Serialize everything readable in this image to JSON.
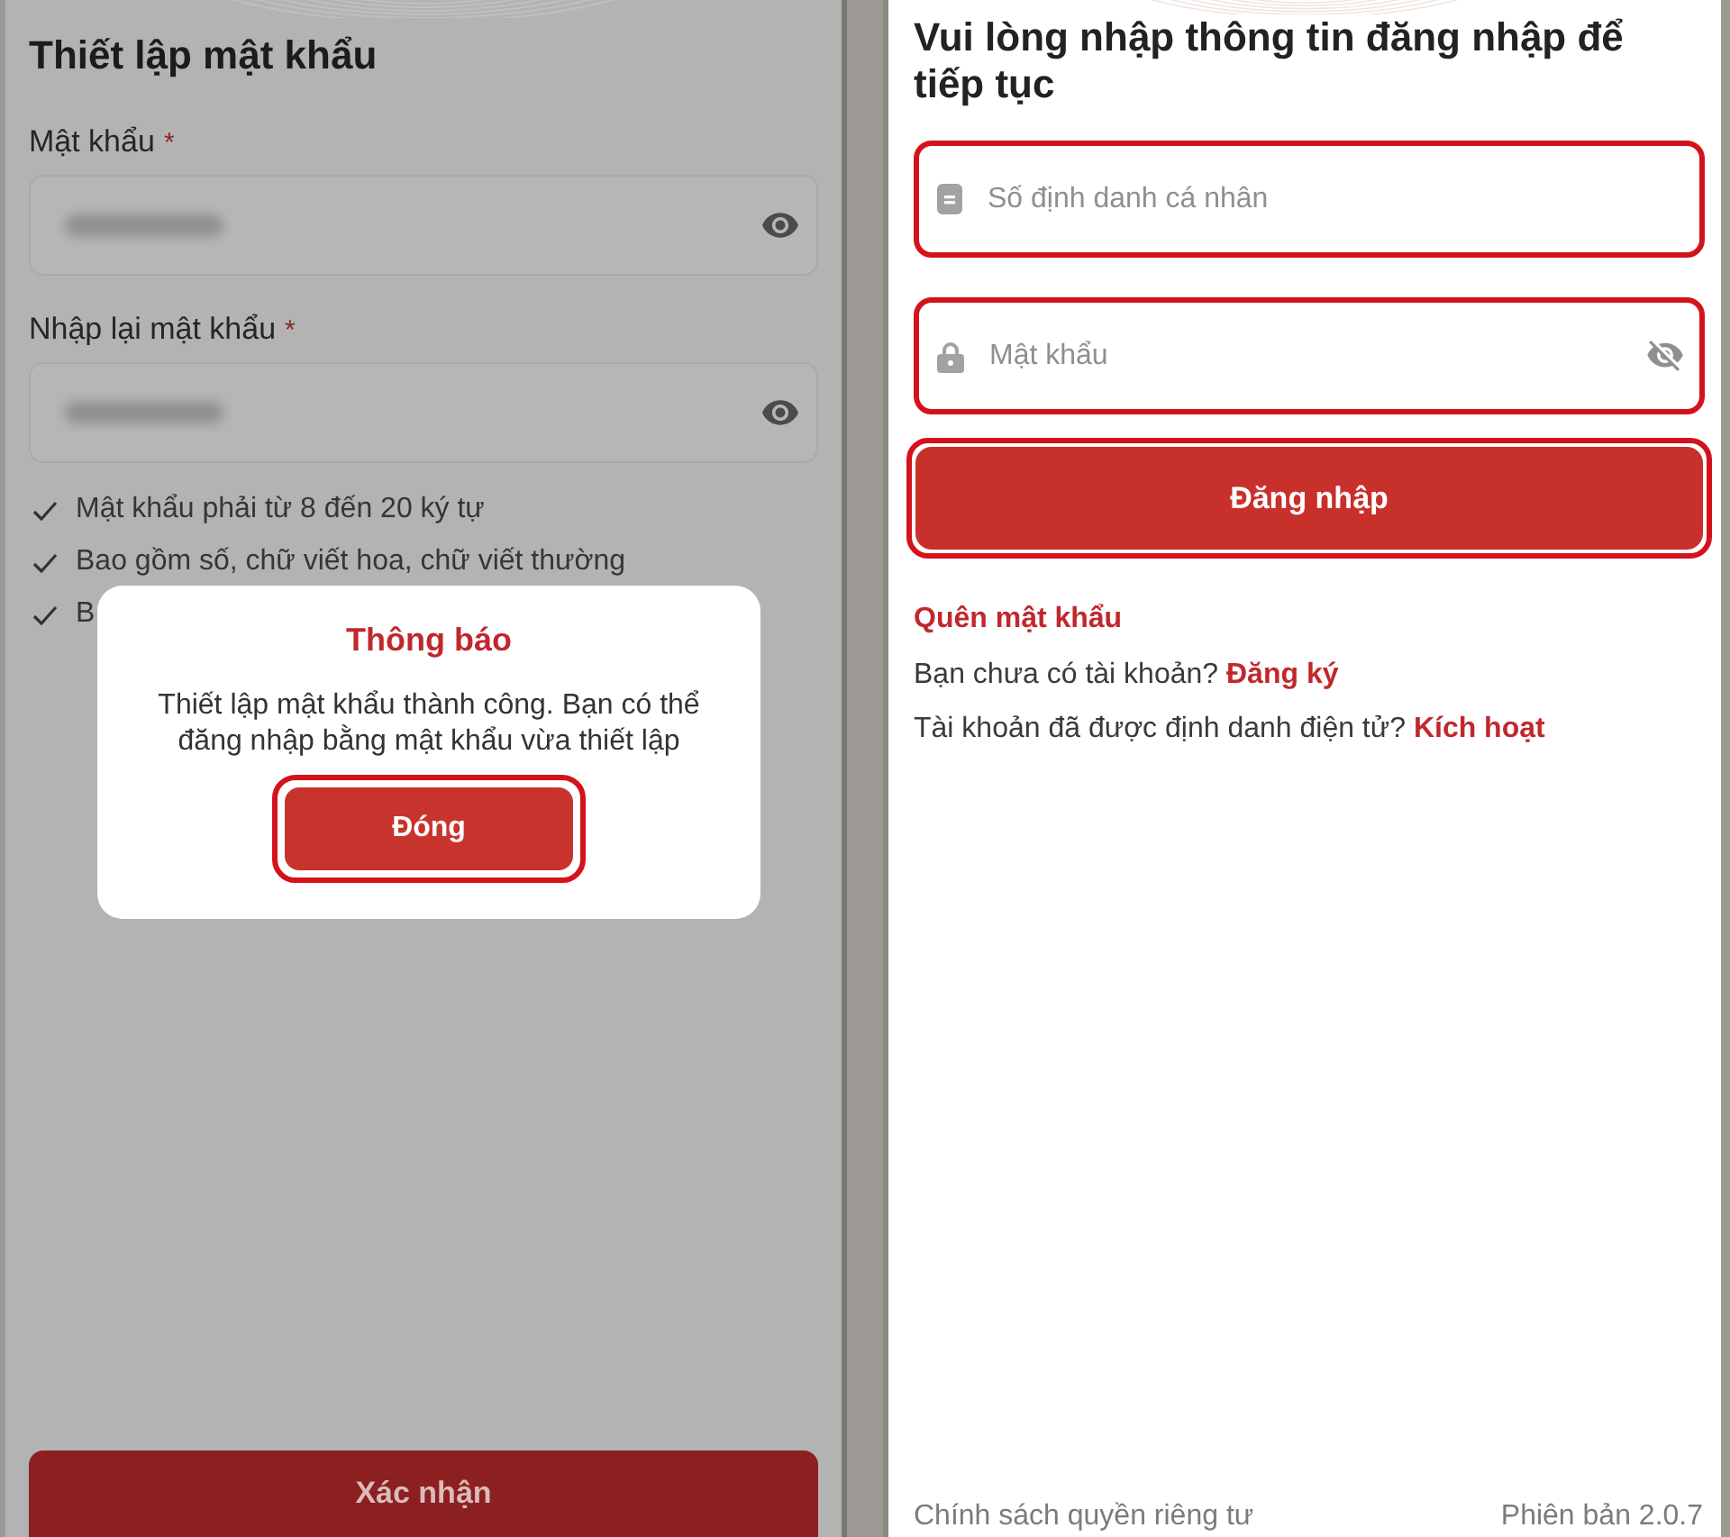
{
  "setup_screen": {
    "title": "Thiết lập mật khẩu",
    "fields": [
      {
        "label": "Mật khẩu",
        "required_mark": "*",
        "blurred": true
      },
      {
        "label": "Nhập lại mật khẩu",
        "required_mark": "*",
        "blurred": true
      }
    ],
    "rules": [
      "Mật khẩu phải từ 8 đến 20 ký tự",
      "Bao gồm số, chữ viết hoa, chữ viết thường",
      "B"
    ],
    "confirm_button": {
      "label": "Xác nhận",
      "highlighted": false
    },
    "dialog": {
      "title": "Thông báo",
      "message": "Thiết lập mật khẩu thành công. Bạn có thể đăng nhập bằng mật khẩu vừa thiết lập",
      "button": {
        "label": "Đóng",
        "highlighted": true
      }
    }
  },
  "login_screen": {
    "title": "Vui lòng nhập thông tin đăng nhập để tiếp tục",
    "fields": [
      {
        "kind": "id",
        "placeholder": "Số định danh cá nhân",
        "highlighted": true
      },
      {
        "kind": "password",
        "placeholder": "Mật khẩu",
        "highlighted": true
      }
    ],
    "login_button": {
      "label": "Đăng nhập",
      "highlighted": true
    },
    "forgot_link": "Quên mật khẩu",
    "prompts": [
      {
        "text": "Bạn chưa có tài khoản?",
        "link": "Đăng ký"
      },
      {
        "text": "Tài khoản đã được định danh điện tử?",
        "link": "Kích hoạt"
      }
    ],
    "footer": {
      "privacy_link": "Chính sách quyền riêng tư",
      "version": "Phiên bản 2.0.7"
    }
  }
}
